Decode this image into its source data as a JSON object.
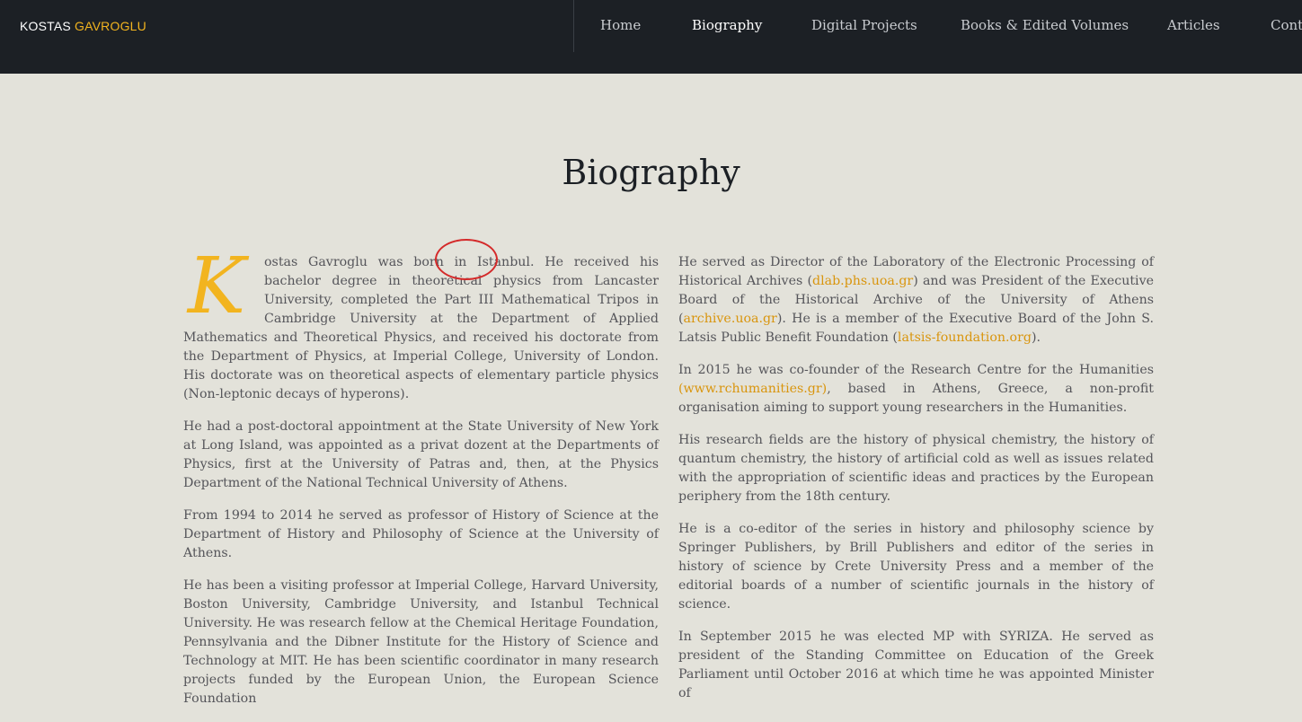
{
  "header": {
    "logo_first": "KOSTAS ",
    "logo_last": "GAVROGLU",
    "nav": [
      {
        "label": "Home"
      },
      {
        "label": "Biography"
      },
      {
        "label": "Digital Projects"
      },
      {
        "label": "Books & Edited Volumes"
      },
      {
        "label": "Articles"
      },
      {
        "label": "Contact"
      }
    ]
  },
  "page": {
    "title": "Biography"
  },
  "left": {
    "dropcap": "K",
    "p1_a": "ostas Gavroglu was born in ",
    "p1_city": "Istanbul.",
    "p1_b": " He received his bachelor degree in theoretical physics from Lancaster University, completed the Part III Mathematical Tripos in Cambridge University at the Department of Applied Mathematics and Theoretical Physics, and received his doctorate from the Department of Physics, at Imperial College, University of London. His doctorate was on theoretical aspects of elementary particle physics (Non-leptonic decays of hyperons).",
    "p2": "He had a post-doctoral appointment at the State University of New York at Long Island, was appointed as a privat dozent at the Departments of Physics, first at the University of Patras and, then, at the Physics Department of the National Technical University of Athens.",
    "p3": "From 1994 to 2014 he served as professor of History of Science at the Department of History and Philosophy of Science at the University of Athens.",
    "p4": "He has been a visiting professor at Imperial College, Harvard University, Boston University, Cambridge University, and Istanbul Technical University. He was research fellow at the Chemical Heritage Foundation, Pennsylvania and the Dibner Institute for the History of Science and Technology at MIT. He has been scientific coordinator in many research projects funded by the European Union, the European Science Foundation"
  },
  "right": {
    "p1_a": "He served as Director of the Laboratory of the Electronic Processing of Historical Archives (",
    "p1_link1": "dlab.phs.uoa.gr",
    "p1_b": ") and was President of the Executive Board of the Historical Archive of the University of Athens (",
    "p1_link2": "archive.uoa.gr",
    "p1_c": "). He is a member of the Executive Board of the John S. Latsis Public Benefit Foundation (",
    "p1_link3": "latsis-foundation.org",
    "p1_d": ").",
    "p2_a": "In 2015 he was co-founder of the Research Centre for the Humanities ",
    "p2_link": "(www.rchumanities.gr)",
    "p2_b": ", based in Athens, Greece, a non-profit organisation aiming to support young researchers in the Humanities.",
    "p3": "His research fields are the history of physical chemistry, the history of quantum chemistry, the history of artificial cold as well as issues related with the appropriation of scientific ideas and practices by the European periphery from the 18th century.",
    "p4": "He is a co-editor of the series in history and philosophy science by Springer Publishers, by Brill Publishers and editor of the series in history of science by Crete University Press and a member of the editorial boards of a number of scientific journals in the history of science.",
    "p5": "In September 2015 he was elected MP with SYRIZA. He served as president of the Standing Committee on Education of the Greek Parliament until October 2016 at which time he was appointed Minister of"
  }
}
